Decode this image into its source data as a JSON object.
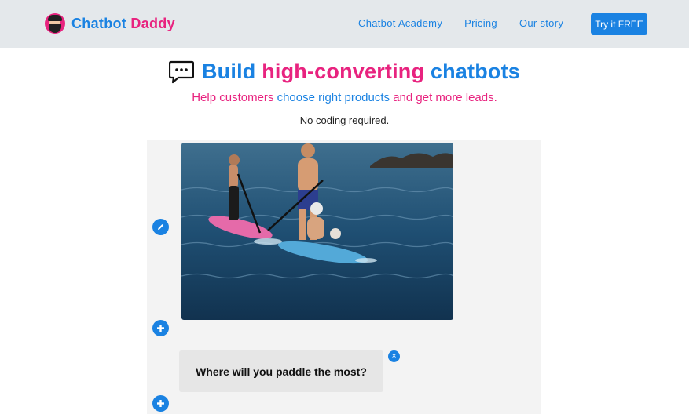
{
  "navbar": {
    "brand": {
      "part1": "Chatbot",
      "part2": "Daddy",
      "logo_icon": "bearded-man-logo"
    },
    "links": [
      {
        "label": "Chatbot Academy"
      },
      {
        "label": "Pricing"
      },
      {
        "label": "Our story"
      }
    ],
    "cta": "Try it FREE"
  },
  "hero": {
    "icon": "chat-bubble-icon",
    "title": {
      "part1": "Build",
      "part2": "high-converting",
      "part3": "chatbots"
    },
    "subtitle": {
      "part1": "Help customers",
      "part2": "choose right products",
      "part3": "and get more leads."
    },
    "tagline": "No coding required."
  },
  "builder": {
    "image_icon": "paddleboard-photo",
    "question": "Where will you paddle the most?",
    "edit_icon": "pencil-icon",
    "add_icon": "plus-icon",
    "close_label": "×"
  },
  "colors": {
    "brand_blue": "#1a82e2",
    "brand_pink": "#e8237f",
    "navbar_bg": "#e4e8eb"
  }
}
